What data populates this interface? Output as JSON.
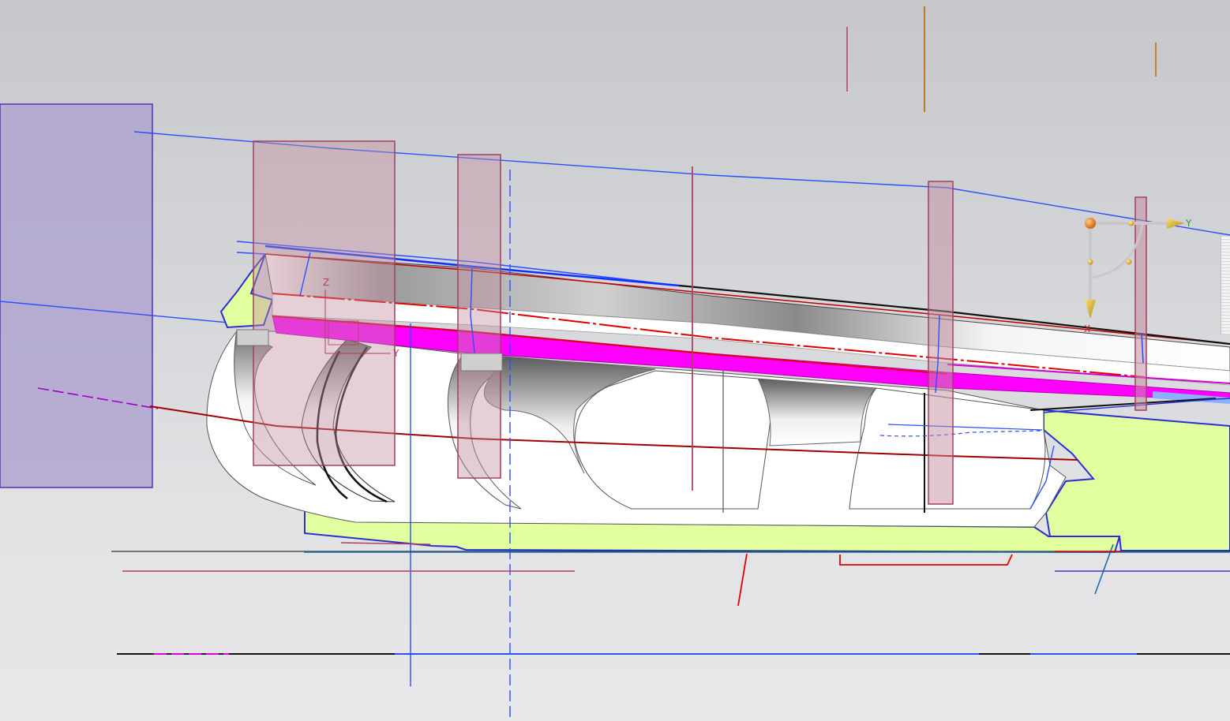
{
  "view": {
    "background_top": "#c6c7ca",
    "background_bottom": "#e8e8ea"
  },
  "manipulator": {
    "x_label": "X",
    "y_label": "Y",
    "origin_color": "#e07a10",
    "arrow_color": "#c8a020",
    "x_label_color": "#c02020",
    "y_label_color": "#20a020"
  },
  "csys_triad": {
    "z_label": "Z",
    "y_label": "Y",
    "color": "#b04060"
  },
  "colors": {
    "datum_plane_fill": "#c48ea0",
    "datum_plane_stroke": "#a04060",
    "large_plane_fill": "#b0a4d0",
    "large_plane_stroke": "#5030c0",
    "curve_blue": "#2a4fff",
    "curve_red": "#c00000",
    "face_magenta": "#ff00ff",
    "sheet_yellow_green": "#e2ffa0",
    "edge_black": "#111111"
  },
  "icons": {
    "manipulator": "dynamic-csys-handle-icon",
    "triad": "wcs-triad-icon"
  }
}
